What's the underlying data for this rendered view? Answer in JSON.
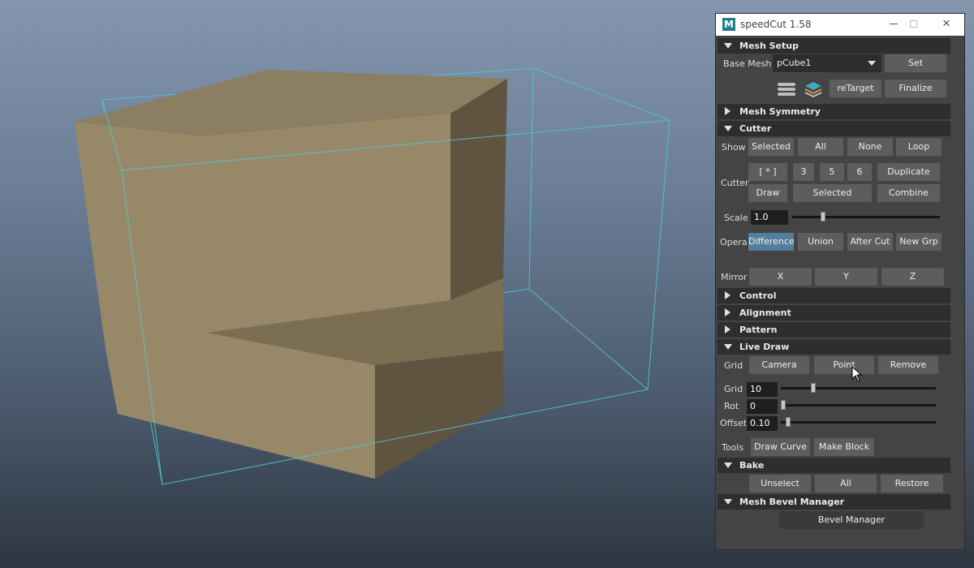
{
  "window": {
    "app_icon": "M",
    "title": "speedCut 1.58",
    "minimize_icon": "minimize-icon",
    "maximize_icon": "maximize-icon",
    "close_glyph": "✕"
  },
  "sections": {
    "mesh_setup": "Mesh Setup",
    "mesh_symmetry": "Mesh Symmetry",
    "cutter": "Cutter",
    "control": "Control",
    "alignment": "Alignment",
    "pattern": "Pattern",
    "live_draw": "Live Draw",
    "bake": "Bake",
    "mesh_bevel_manager": "Mesh Bevel Manager"
  },
  "mesh_setup": {
    "base_mesh_label": "Base Mesh",
    "base_mesh_value": "pCube1",
    "set": "Set",
    "retarget": "reTarget",
    "finalize": "Finalize"
  },
  "cutter": {
    "show_label": "Show",
    "show_selected": "Selected",
    "show_all": "All",
    "show_none": "None",
    "show_loop": "Loop",
    "cutter_label": "Cutter",
    "bracket_star": "[ * ]",
    "num_3": "3",
    "num_5": "5",
    "num_6": "6",
    "duplicate": "Duplicate",
    "draw": "Draw",
    "selected": "Selected",
    "combine": "Combine",
    "scale_label": "Scale",
    "scale_value": "1.0",
    "scale_slider": 0.2,
    "opera_label": "Opera",
    "difference": "Difference",
    "union": "Union",
    "after_cut": "After Cut",
    "new_grp": "New Grp",
    "mirror_label": "Mirror",
    "mirror_x": "X",
    "mirror_y": "Y",
    "mirror_z": "Z"
  },
  "live_draw": {
    "grid_label": "Grid",
    "camera": "Camera",
    "point": "Point",
    "remove": "Remove",
    "grid_value_label": "Grid",
    "grid_value": "10",
    "grid_slider": 0.2,
    "rot_label": "Rot",
    "rot_value": "0",
    "rot_slider": 0.0,
    "offset_label": "Offset",
    "offset_value": "0.10",
    "offset_slider": 0.03,
    "tools_label": "Tools",
    "draw_curve": "Draw Curve",
    "make_block": "Make Block"
  },
  "bake": {
    "unselect": "Unselect",
    "all": "All",
    "restore": "Restore"
  },
  "bevel": {
    "bevel_manager": "Bevel Manager"
  },
  "colors": {
    "panel_bg": "#444444",
    "section_bg": "#2e2e2e",
    "button_bg": "#5d5d5d",
    "active_button": "#527f9e",
    "mesh_top": "#8c7e62",
    "mesh_front": "#978968",
    "mesh_side": "#5f5440",
    "wireframe": "#4fc6cc"
  }
}
